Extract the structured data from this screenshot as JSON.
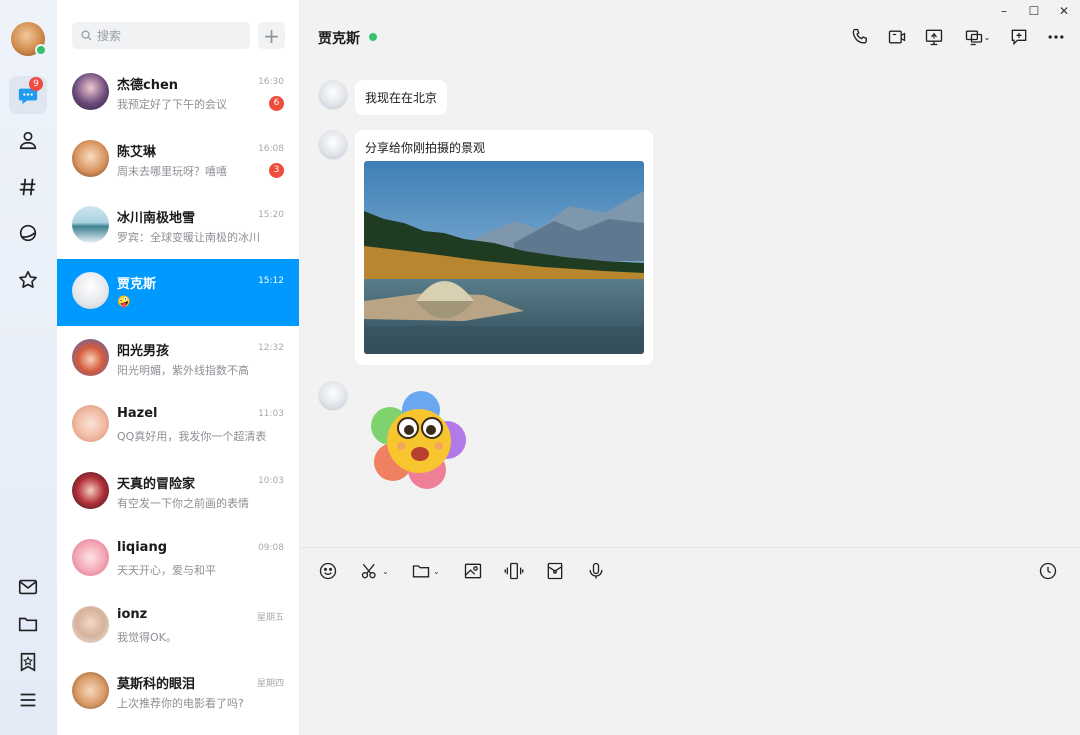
{
  "window": {
    "minimize": "–",
    "maximize": "☐",
    "close": "✕"
  },
  "rail": {
    "messages_badge": "9"
  },
  "search": {
    "placeholder": "搜索"
  },
  "add_button": "+",
  "conversations": [
    {
      "name": "杰德chen",
      "time": "16:30",
      "preview": "我预定好了下午的会议",
      "count": "6"
    },
    {
      "name": "陈艾琳",
      "time": "16:08",
      "preview": "周末去哪里玩呀？嘻嘻",
      "count": "3"
    },
    {
      "name": "冰川南极地雪",
      "time": "15:20",
      "preview": "罗宾：全球变暖让南极的冰川",
      "count": ""
    },
    {
      "name": "贾克斯",
      "time": "15:12",
      "preview": "🤪",
      "count": ""
    },
    {
      "name": "阳光男孩",
      "time": "12:32",
      "preview": "阳光明媚，紫外线指数不高",
      "count": ""
    },
    {
      "name": "Hazel",
      "time": "11:03",
      "preview": "QQ真好用，我发你一个超清表情",
      "count": ""
    },
    {
      "name": "天真的冒险家",
      "time": "10:03",
      "preview": "有空发一下你之前画的表情",
      "count": ""
    },
    {
      "name": "liqiang",
      "time": "09:08",
      "preview": "天天开心，爱与和平",
      "count": ""
    },
    {
      "name": "ionz",
      "time": "星期五",
      "preview": "我觉得OK。",
      "count": ""
    },
    {
      "name": "莫斯科的眼泪",
      "time": "星期四",
      "preview": "上次推荐你的电影看了吗?",
      "count": ""
    }
  ],
  "chat": {
    "title": "贾克斯",
    "messages": [
      {
        "type": "text",
        "text": "我现在在北京"
      },
      {
        "type": "image",
        "text": "分享给你刚拍摄的景观"
      },
      {
        "type": "sticker",
        "text": ""
      }
    ]
  }
}
